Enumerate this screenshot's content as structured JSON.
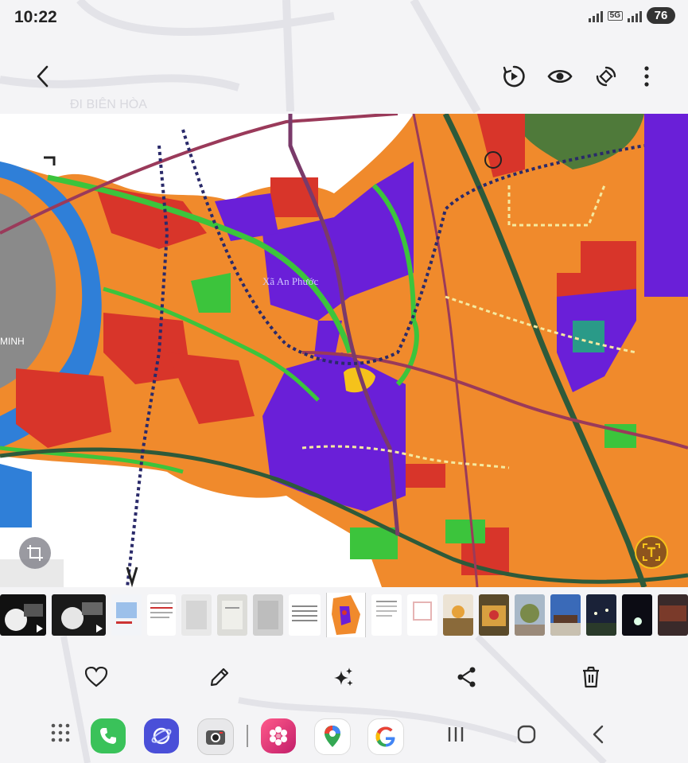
{
  "status_bar": {
    "time": "10:22",
    "network": "5G",
    "battery": "76"
  },
  "top_bar": {
    "back_icon": "chevron-left-icon",
    "actions": [
      "play-motion-icon",
      "eye-icon",
      "rotate-icon",
      "more-vert-icon"
    ]
  },
  "map": {
    "labels": {
      "top_left": "ĐI BIÊN HÒA",
      "center": "Xã An Phước",
      "left_edge": "MINH"
    },
    "overlay_buttons": [
      "crop-icon",
      "text-extract-icon"
    ]
  },
  "thumbnails": {
    "count": 20,
    "selected_index": 9
  },
  "actions": [
    "heart-icon",
    "pencil-icon",
    "sparkle-icon",
    "share-icon",
    "trash-icon"
  ],
  "nav": {
    "apps": [
      "app-drawer-icon",
      "phone-app-icon",
      "internet-app-icon",
      "camera-app-icon",
      "gallery-app-icon",
      "maps-app-icon",
      "google-app-icon"
    ],
    "system": [
      "recents-icon",
      "home-icon",
      "back-icon"
    ]
  },
  "colors": {
    "accent_orange": "#f08a2c",
    "land_purple": "#6a1fd8",
    "land_red": "#d8352a",
    "water_blue": "#2f7fd8",
    "green": "#3cc43c"
  }
}
